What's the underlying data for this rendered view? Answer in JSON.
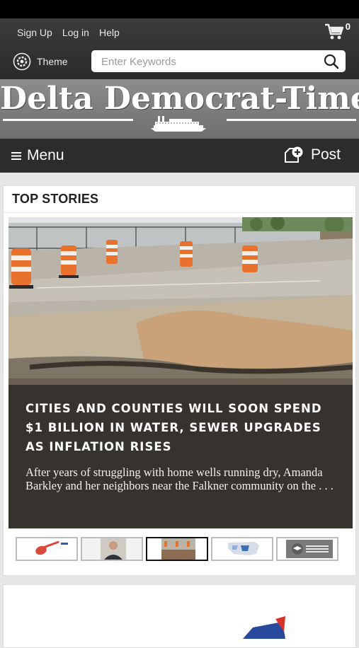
{
  "header": {
    "links": [
      "Sign Up",
      "Log in",
      "Help"
    ],
    "cart_count": "0",
    "theme_label": "Theme",
    "search_placeholder": "Enter Keywords"
  },
  "masthead": {
    "title": "Delta Democrat-Times"
  },
  "nav": {
    "menu_label": "Menu",
    "post_label": "Post"
  },
  "top_stories": {
    "heading": "TOP STORIES",
    "headline": "Cities and counties will soon spend $1 billion in water, sewer upgrades as inflation rises",
    "summary": "After years of struggling with home wells running dry, Amanda Barkley and her neighbors near the Falkner community on the . . .",
    "thumbnails": [
      {
        "name": "guitar-thumbnail",
        "active": false
      },
      {
        "name": "portrait-thumbnail",
        "active": false
      },
      {
        "name": "road-repair-thumbnail",
        "active": true
      },
      {
        "name": "map-thumbnail",
        "active": false
      },
      {
        "name": "mississippi-education-thumbnail",
        "active": false,
        "caption": "MISSISSIPPI DEPARTMENT OF EDUCATION"
      }
    ]
  }
}
